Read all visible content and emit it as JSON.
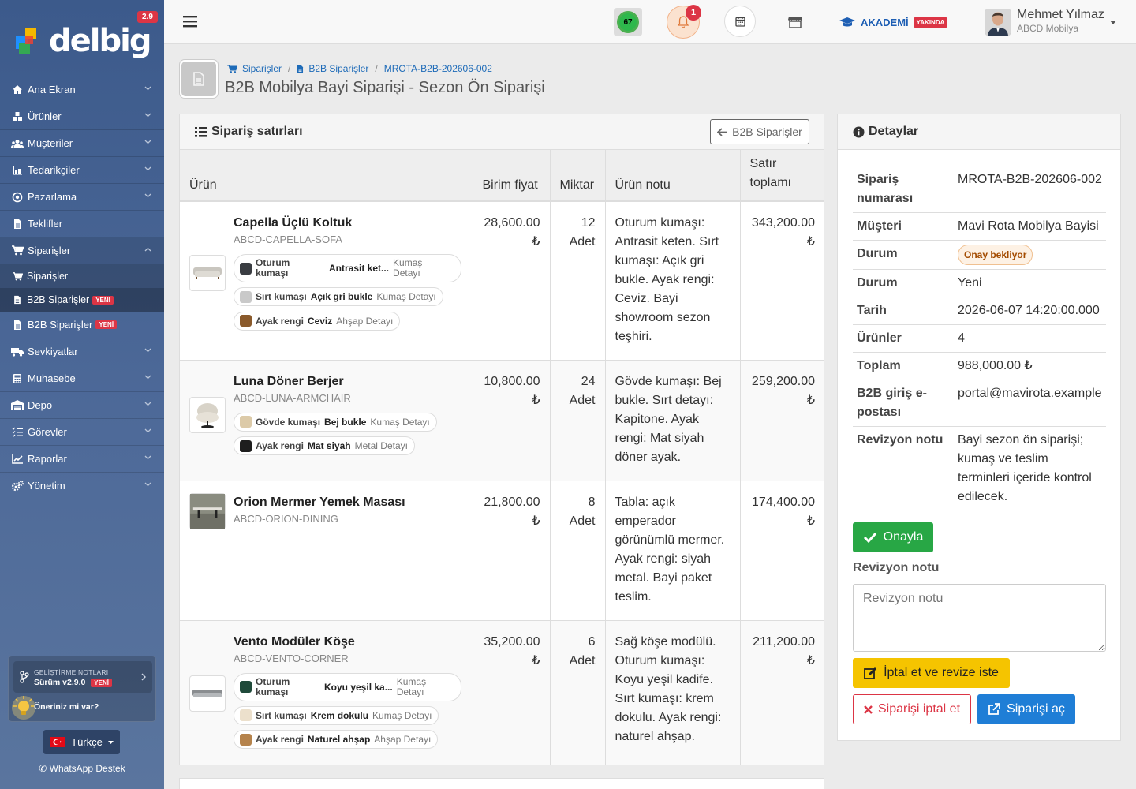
{
  "app": {
    "logo_text": "delbig",
    "version_badge": "2.9"
  },
  "sidebar": {
    "items": [
      {
        "label": "Ana Ekran",
        "icon": "home-icon"
      },
      {
        "label": "Ürünler",
        "icon": "cubes-icon"
      },
      {
        "label": "Müşteriler",
        "icon": "users-icon"
      },
      {
        "label": "Tedarikçiler",
        "icon": "truck-loading-icon"
      },
      {
        "label": "Pazarlama",
        "icon": "bullseye-icon"
      },
      {
        "label": "Teklifler",
        "icon": "file-icon"
      },
      {
        "label": "Siparişler",
        "icon": "cart-icon"
      },
      {
        "label": "Siparişler",
        "icon": "cart-icon"
      },
      {
        "label": "B2B Siparişler",
        "icon": "file-icon",
        "badge": "YENİ"
      },
      {
        "label": "B2B Siparişler",
        "icon": "file-icon",
        "badge": "YENİ"
      },
      {
        "label": "Sevkiyatlar",
        "icon": "truck-icon"
      },
      {
        "label": "Muhasebe",
        "icon": "calculator-icon"
      },
      {
        "label": "Depo",
        "icon": "warehouse-icon"
      },
      {
        "label": "Görevler",
        "icon": "tasks-icon"
      },
      {
        "label": "Raporlar",
        "icon": "chart-icon"
      },
      {
        "label": "Yönetim",
        "icon": "cogs-icon"
      }
    ],
    "notes": {
      "small": "GELİŞTİRME NOTLARI",
      "version": "Sürüm v2.9.0",
      "badge": "YENİ",
      "suggest": "Öneriniz mi var?"
    },
    "language": "Türkçe",
    "whatsapp": "WhatsApp Destek"
  },
  "topbar": {
    "score": "67",
    "notif_count": "1",
    "academy": "AKADEMİ",
    "academy_badge": "YAKINDA",
    "user_name": "Mehmet Yılmaz",
    "user_company": "ABCD Mobilya"
  },
  "breadcrumb": {
    "items": [
      "Siparişler",
      "B2B Siparişler",
      "MROTA-B2B-202606-002"
    ]
  },
  "page_title": "B2B Mobilya Bayi Siparişi - Sezon Ön Siparişi",
  "lines_panel": {
    "title": "Sipariş satırları",
    "back_button": "B2B Siparişler",
    "headers": {
      "product": "Ürün",
      "unit_price": "Birim fiyat",
      "qty": "Miktar",
      "note": "Ürün notu",
      "total_line1": "Satır",
      "total_line2": "toplamı"
    },
    "rows": [
      {
        "name": "Capella Üçlü Koltuk",
        "sku": "ABCD-CAPELLA-SOFA",
        "price": "28,600.00",
        "currency": "₺",
        "qty": "12",
        "unit": "Adet",
        "note": "Oturum kumaşı: Antrasit keten. Sırt kumaşı: Açık gri bukle. Ayak rengi: Ceviz. Bayi showroom sezon teşhiri.",
        "total": "343,200.00",
        "chips": [
          {
            "label": "Oturum kumaşı",
            "value": "Antrasit ket...",
            "kind": "Kumaş Detayı",
            "color": "#3a3d42"
          },
          {
            "label": "Sırt kumaşı",
            "value": "Açık gri bukle",
            "kind": "Kumaş Detayı",
            "color": "#c9c9c9"
          },
          {
            "label": "Ayak rengi",
            "value": "Ceviz",
            "kind": "Ahşap Detayı",
            "color": "#8a5a2b"
          }
        ]
      },
      {
        "name": "Luna Döner Berjer",
        "sku": "ABCD-LUNA-ARMCHAIR",
        "price": "10,800.00",
        "currency": "₺",
        "qty": "24",
        "unit": "Adet",
        "note": "Gövde kumaşı: Bej bukle. Sırt detayı: Kapitone. Ayak rengi: Mat siyah döner ayak.",
        "total": "259,200.00",
        "chips": [
          {
            "label": "Gövde kumaşı",
            "value": "Bej bukle",
            "kind": "Kumaş Detayı",
            "color": "#dccaa8"
          },
          {
            "label": "Ayak rengi",
            "value": "Mat siyah",
            "kind": "Metal Detayı",
            "color": "#1e1e1e"
          }
        ]
      },
      {
        "name": "Orion Mermer Yemek Masası",
        "sku": "ABCD-ORION-DINING",
        "price": "21,800.00",
        "currency": "₺",
        "qty": "8",
        "unit": "Adet",
        "note": "Tabla: açık emperador görünümlü mermer. Ayak rengi: siyah metal. Bayi paket teslim.",
        "total": "174,400.00",
        "chips": []
      },
      {
        "name": "Vento Modüler Köşe",
        "sku": "ABCD-VENTO-CORNER",
        "price": "35,200.00",
        "currency": "₺",
        "qty": "6",
        "unit": "Adet",
        "note": "Sağ köşe modülü. Oturum kumaşı: Koyu yeşil kadife. Sırt kumaşı: krem dokulu. Ayak rengi: naturel ahşap.",
        "total": "211,200.00",
        "chips": [
          {
            "label": "Oturum kumaşı",
            "value": "Koyu yeşil ka...",
            "kind": "Kumaş Detayı",
            "color": "#1f4a3a"
          },
          {
            "label": "Sırt kumaşı",
            "value": "Krem dokulu",
            "kind": "Kumaş Detayı",
            "color": "#ece0cc"
          },
          {
            "label": "Ayak rengi",
            "value": "Naturel ahşap",
            "kind": "Ahşap Detayı",
            "color": "#b5834c"
          }
        ]
      }
    ]
  },
  "details": {
    "title": "Detaylar",
    "rows": [
      {
        "k1": "Sipariş",
        "k2": "numarası",
        "v": "MROTA-B2B-202606-002"
      },
      {
        "k": "Müşteri",
        "v": "Mavi Rota Mobilya Bayisi"
      },
      {
        "k": "Durum",
        "badge": "Onay bekliyor"
      },
      {
        "k": "Durum",
        "v": "Yeni"
      },
      {
        "k": "Tarih",
        "v": "2026-06-07 14:20:00.000"
      },
      {
        "k": "Ürünler",
        "v": "4"
      },
      {
        "k": "Toplam",
        "v": "988,000.00 ₺"
      },
      {
        "k1": "B2B giriş e-",
        "k2": "postası",
        "v": "portal@mavirota.example"
      },
      {
        "k": "Revizyon notu",
        "v": "Bayi sezon ön siparişi; kumaş ve teslim terminleri içeride kontrol edilecek."
      }
    ],
    "approve": "Onayla",
    "revision_label": "Revizyon notu",
    "revision_placeholder": "Revizyon notu",
    "cancel_revise": "İptal et ve revize iste",
    "cancel": "Siparişi iptal et",
    "open": "Siparişi aç"
  }
}
